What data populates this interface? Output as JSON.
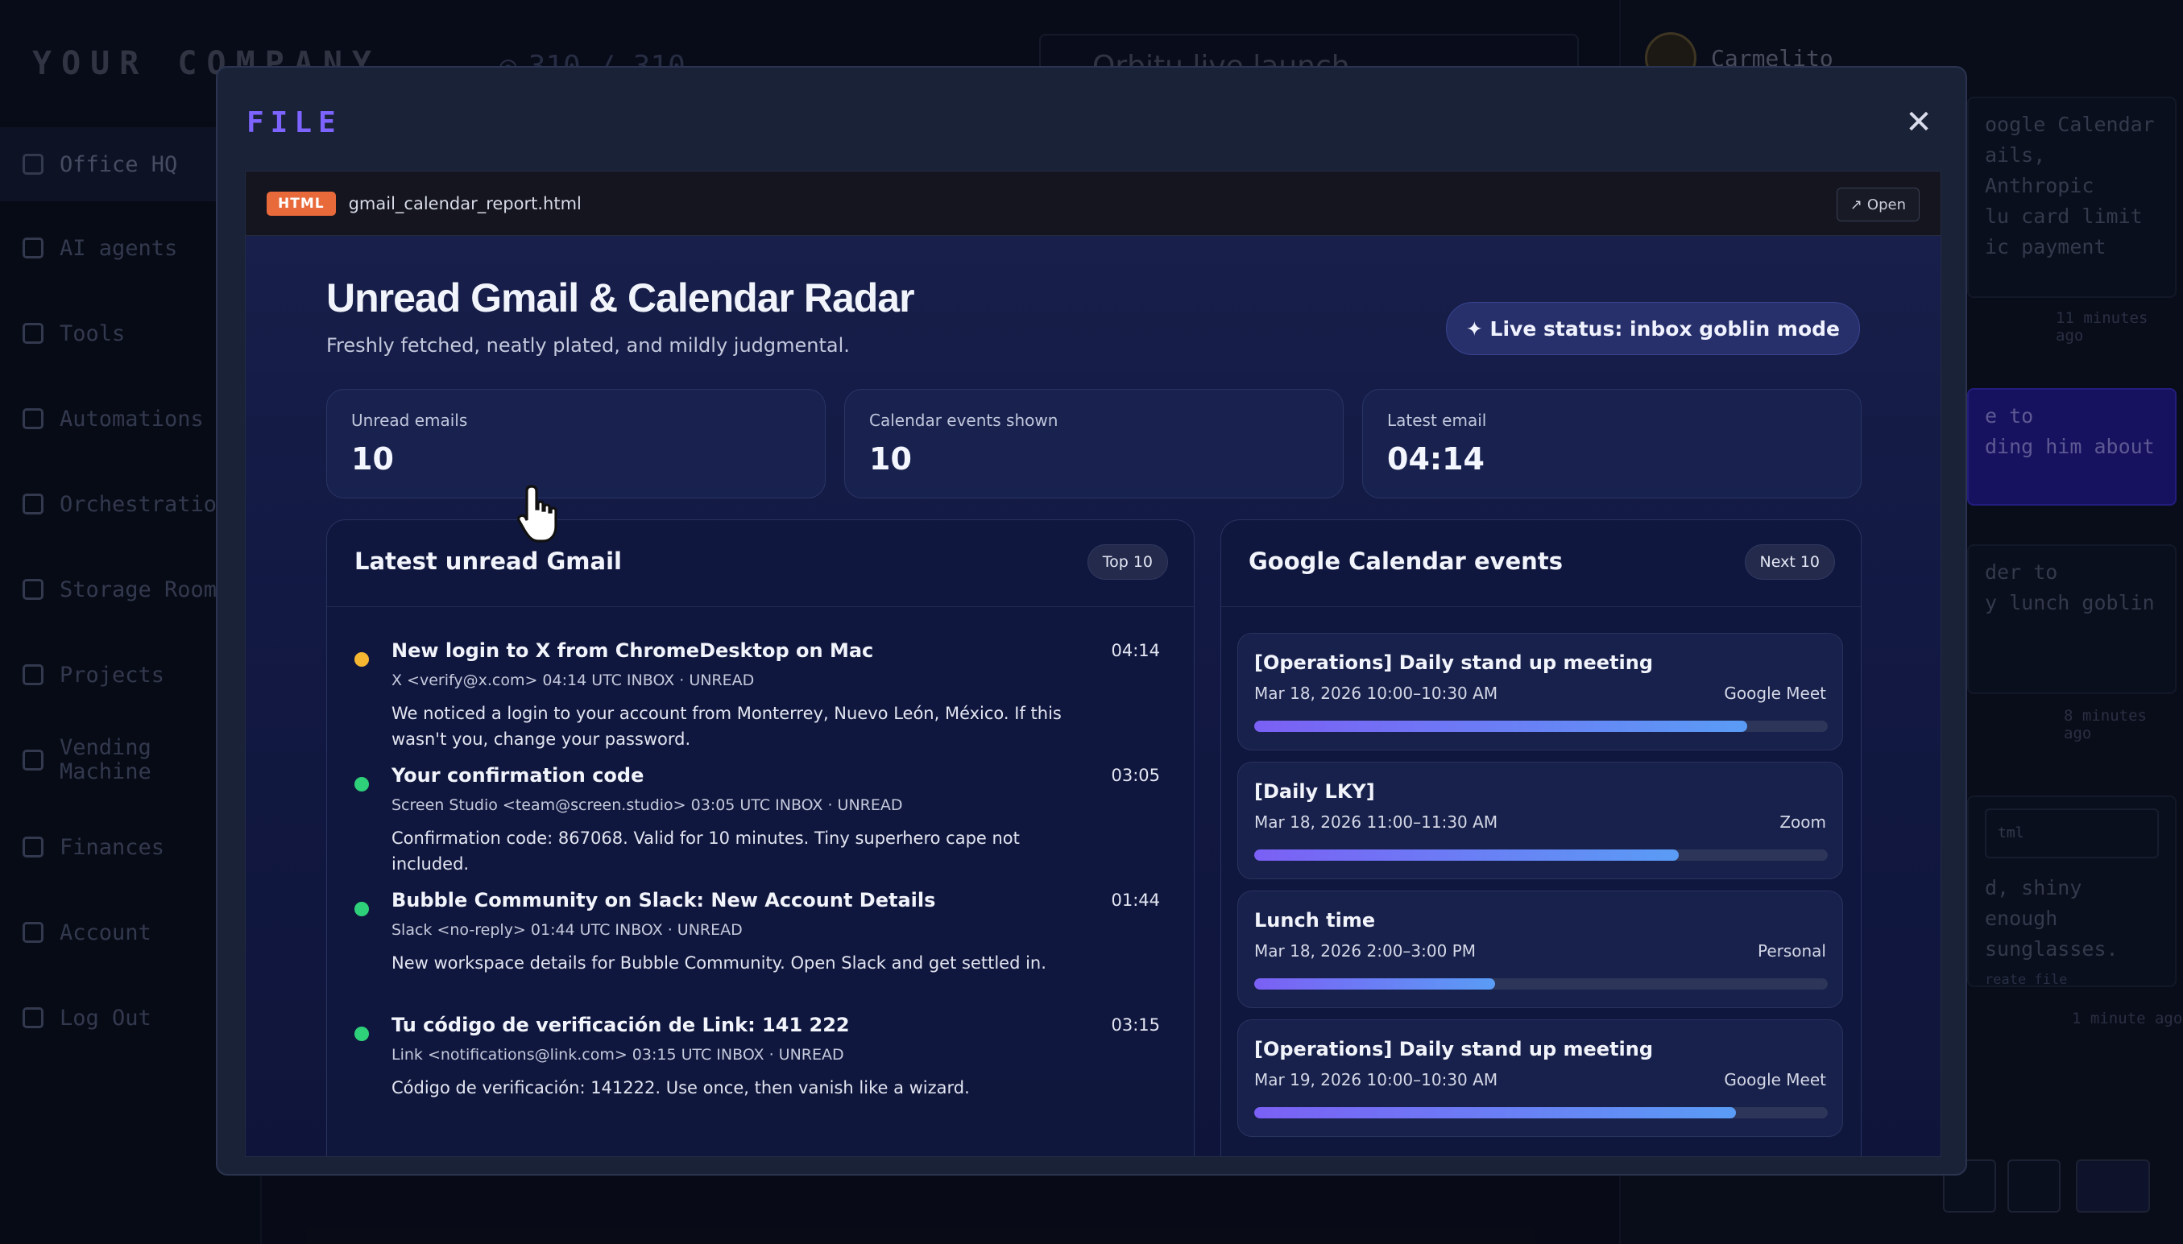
{
  "app": {
    "brand": "YOUR COMPANY",
    "counter": "310 / 310",
    "launch_select": "Orbitu live launch",
    "user_name": "Carmelito"
  },
  "sidebar": {
    "items": [
      {
        "label": "Office HQ",
        "icon": "building-icon"
      },
      {
        "label": "AI agents",
        "icon": "users-icon"
      },
      {
        "label": "Tools",
        "icon": "wrench-icon"
      },
      {
        "label": "Automations",
        "icon": "clock-icon"
      },
      {
        "label": "Orchestration",
        "icon": "hierarchy-icon"
      },
      {
        "label": "Storage Room",
        "icon": "file-icon"
      },
      {
        "label": "Projects",
        "icon": "pencil-icon"
      },
      {
        "label": "Vending Machine",
        "icon": "gear-icon"
      },
      {
        "label": "Finances",
        "icon": "chart-icon"
      },
      {
        "label": "Account",
        "icon": "user-circle-icon"
      },
      {
        "label": "Log Out",
        "icon": "logout-icon"
      }
    ]
  },
  "right_panel": {
    "card1": "oogle Calendar\nails, Anthropic\nlu card limit\nic payment",
    "time1": "11 minutes ago",
    "card2": "e to\nding him about",
    "card3": "der to\ny lunch goblin",
    "time2": "8 minutes ago",
    "card4_file": "tml",
    "card4": "d, shiny enough\nsunglasses.",
    "card4_link": "reate file",
    "time3": "1 minute ago"
  },
  "modal": {
    "title": "FILE",
    "close": "✕",
    "file_type": "HTML",
    "file_name": "gmail_calendar_report.html",
    "open_label": "Open"
  },
  "report": {
    "title": "Unread Gmail & Calendar Radar",
    "subtitle": "Freshly fetched, neatly plated, and mildly judgmental.",
    "status": "✦ Live status: inbox goblin mode",
    "stats": [
      {
        "label": "Unread emails",
        "value": "10"
      },
      {
        "label": "Calendar events shown",
        "value": "10"
      },
      {
        "label": "Latest email",
        "value": "04:14"
      }
    ],
    "gmail_panel": {
      "title": "Latest unread Gmail",
      "tag": "Top 10"
    },
    "calendar_panel": {
      "title": "Google Calendar events",
      "tag": "Next 10"
    },
    "emails": [
      {
        "subject": "New login to X from ChromeDesktop on Mac",
        "time": "04:14",
        "meta": "X <verify@x.com>     04:14 UTC     INBOX · UNREAD",
        "body": "We noticed a login to your account from Monterrey, Nuevo León, México. If this wasn't you, change your password.",
        "dot_color": "#f5b731"
      },
      {
        "subject": "Your confirmation code",
        "time": "03:05",
        "meta": "Screen Studio <team@screen.studio>     03:05 UTC     INBOX · UNREAD",
        "body": "Confirmation code: 867068. Valid for 10 minutes. Tiny superhero cape not included.",
        "dot_color": "#2fd07a"
      },
      {
        "subject": "Bubble Community on Slack: New Account Details",
        "time": "01:44",
        "meta": "Slack <no-reply>     01:44 UTC     INBOX · UNREAD",
        "body": "New workspace details for Bubble Community. Open Slack and get settled in.",
        "dot_color": "#2fd07a"
      },
      {
        "subject": "Tu código de verificación de Link: 141 222",
        "time": "03:15",
        "meta": "Link <notifications@link.com>     03:15 UTC     INBOX · UNREAD",
        "body": "Código de verificación: 141222. Use once, then vanish like a wizard.",
        "dot_color": "#2fd07a"
      }
    ],
    "events": [
      {
        "title": "[Operations] Daily stand up meeting",
        "date": "Mar 18, 2026 10:00–10:30 AM",
        "location": "Google Meet",
        "progress": 0.86
      },
      {
        "title": "[Daily LKY]",
        "date": "Mar 18, 2026 11:00–11:30 AM",
        "location": "Zoom",
        "progress": 0.74
      },
      {
        "title": "Lunch time",
        "date": "Mar 18, 2026 2:00–3:00 PM",
        "location": "Personal",
        "progress": 0.42
      },
      {
        "title": "[Operations] Daily stand up meeting",
        "date": "Mar 19, 2026 10:00–10:30 AM",
        "location": "Google Meet",
        "progress": 0.84
      }
    ]
  }
}
